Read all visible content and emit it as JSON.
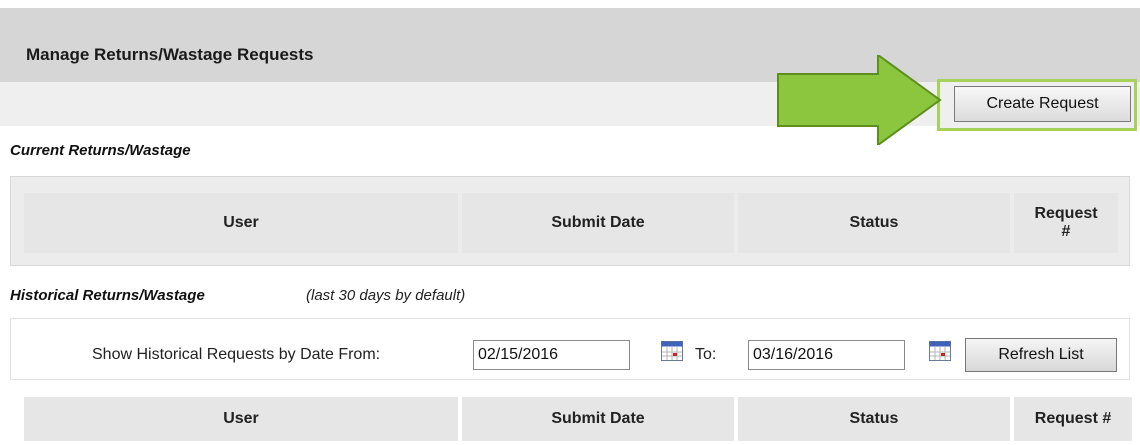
{
  "header": {
    "title": "Manage Returns/Wastage Requests"
  },
  "toolbar": {
    "create_label": "Create Request"
  },
  "current": {
    "label": "Current Returns/Wastage",
    "columns": [
      "User",
      "Submit Date",
      "Status",
      "Request #"
    ]
  },
  "historical": {
    "label": "Historical Returns/Wastage",
    "note": "(last 30 days by default)",
    "filter": {
      "from_label": "Show Historical Requests by Date From:",
      "from_value": "02/15/2016",
      "to_label": "To:",
      "to_value": "03/16/2016",
      "refresh_label": "Refresh List"
    },
    "columns": [
      "User",
      "Submit Date",
      "Status",
      "Request #"
    ]
  },
  "colors": {
    "highlight": "#a6d25a",
    "arrow_fill": "#8cc63f",
    "arrow_stroke": "#5d8f1f"
  },
  "icons": {
    "calendar": "calendar-icon",
    "arrow": "pointer-arrow-icon"
  }
}
